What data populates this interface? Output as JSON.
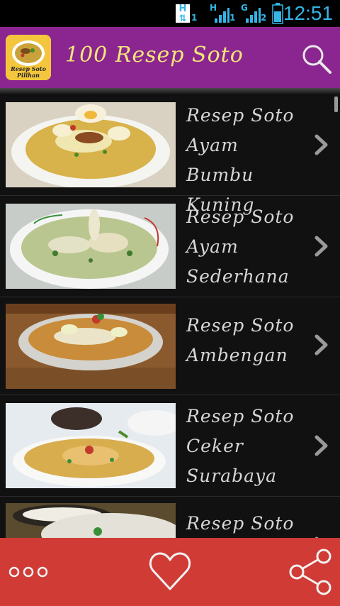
{
  "status_bar": {
    "h_indicator": "H",
    "sim1_type": "H",
    "sim1_slot": "1",
    "sim2_type": "G",
    "sim2_slot": "2",
    "h_slot": "1",
    "time": "12:51"
  },
  "app_bar": {
    "icon_text_line1": "Resep Soto",
    "icon_text_line2": "Pilihan",
    "title": "100 Resep Soto",
    "search_icon": "search-icon"
  },
  "recipes": [
    {
      "title_lines": [
        "Resep Soto",
        "Ayam Bumbu",
        "Kuning"
      ]
    },
    {
      "title_lines": [
        "Resep Soto",
        "Ayam",
        "Sederhana"
      ]
    },
    {
      "title_lines": [
        "Resep Soto",
        "Ambengan"
      ]
    },
    {
      "title_lines": [
        "Resep Soto",
        "Ceker",
        "Surabaya"
      ]
    },
    {
      "title_lines": [
        "Resep Soto"
      ]
    }
  ],
  "bottom_bar": {
    "more_icon": "more-dots-icon",
    "favorite_icon": "heart-icon",
    "share_icon": "share-icon"
  },
  "colors": {
    "app_bar": "#8b2690",
    "title": "#f2e67a",
    "bottom_bar": "#d03b36",
    "status_accent": "#35b5e5"
  }
}
